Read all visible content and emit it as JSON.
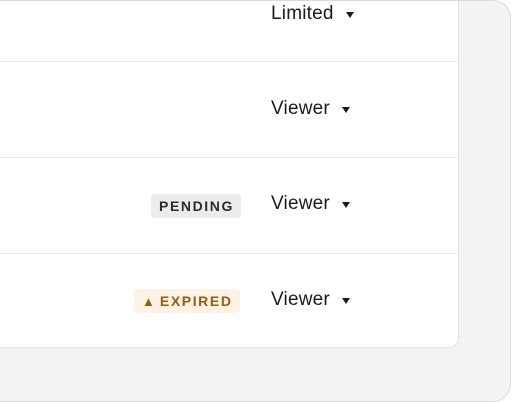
{
  "rows": [
    {
      "role": "Limited",
      "badge": null
    },
    {
      "role": "Viewer",
      "badge": null
    },
    {
      "role": "Viewer",
      "badge": {
        "label": "PENDING",
        "type": "pending",
        "icon": null
      }
    },
    {
      "role": "Viewer",
      "badge": {
        "label": "EXPIRED",
        "type": "expired",
        "icon": "warning-icon"
      }
    }
  ],
  "colors": {
    "pending_bg": "#ececec",
    "expired_bg": "#fdf2e3",
    "expired_text": "#9a5a12"
  }
}
